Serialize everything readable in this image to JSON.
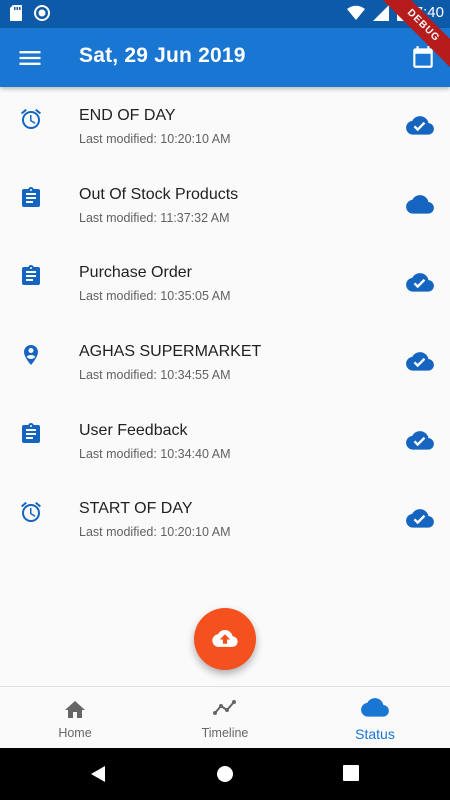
{
  "status_bar": {
    "time": "7:40"
  },
  "app_bar": {
    "title": "Sat, 29 Jun 2019",
    "debug_label": "DEBUG"
  },
  "items": [
    {
      "title": "END OF DAY",
      "subtitle": "Last modified: 10:20:10 AM",
      "icon": "alarm-icon",
      "status_icon": "cloud-done-icon"
    },
    {
      "title": "Out Of Stock Products",
      "subtitle": "Last modified: 11:37:32 AM",
      "icon": "assignment-icon",
      "status_icon": "cloud-icon"
    },
    {
      "title": "Purchase Order",
      "subtitle": "Last modified: 10:35:05 AM",
      "icon": "assignment-icon",
      "status_icon": "cloud-done-icon"
    },
    {
      "title": "AGHAS SUPERMARKET",
      "subtitle": "Last modified: 10:34:55 AM",
      "icon": "location-pin-icon",
      "status_icon": "cloud-done-icon"
    },
    {
      "title": "User Feedback",
      "subtitle": "Last modified: 10:34:40 AM",
      "icon": "assignment-icon",
      "status_icon": "cloud-done-icon"
    },
    {
      "title": "START OF DAY",
      "subtitle": "Last modified: 10:20:10 AM",
      "icon": "alarm-icon",
      "status_icon": "cloud-done-icon"
    }
  ],
  "fab": {
    "icon": "cloud-upload-icon"
  },
  "bottom_nav": {
    "home": "Home",
    "timeline": "Timeline",
    "status": "Status",
    "active": "Status"
  },
  "colors": {
    "primary": "#1976d2",
    "accent": "#f4511e",
    "status_bar": "#0d5ba8"
  }
}
